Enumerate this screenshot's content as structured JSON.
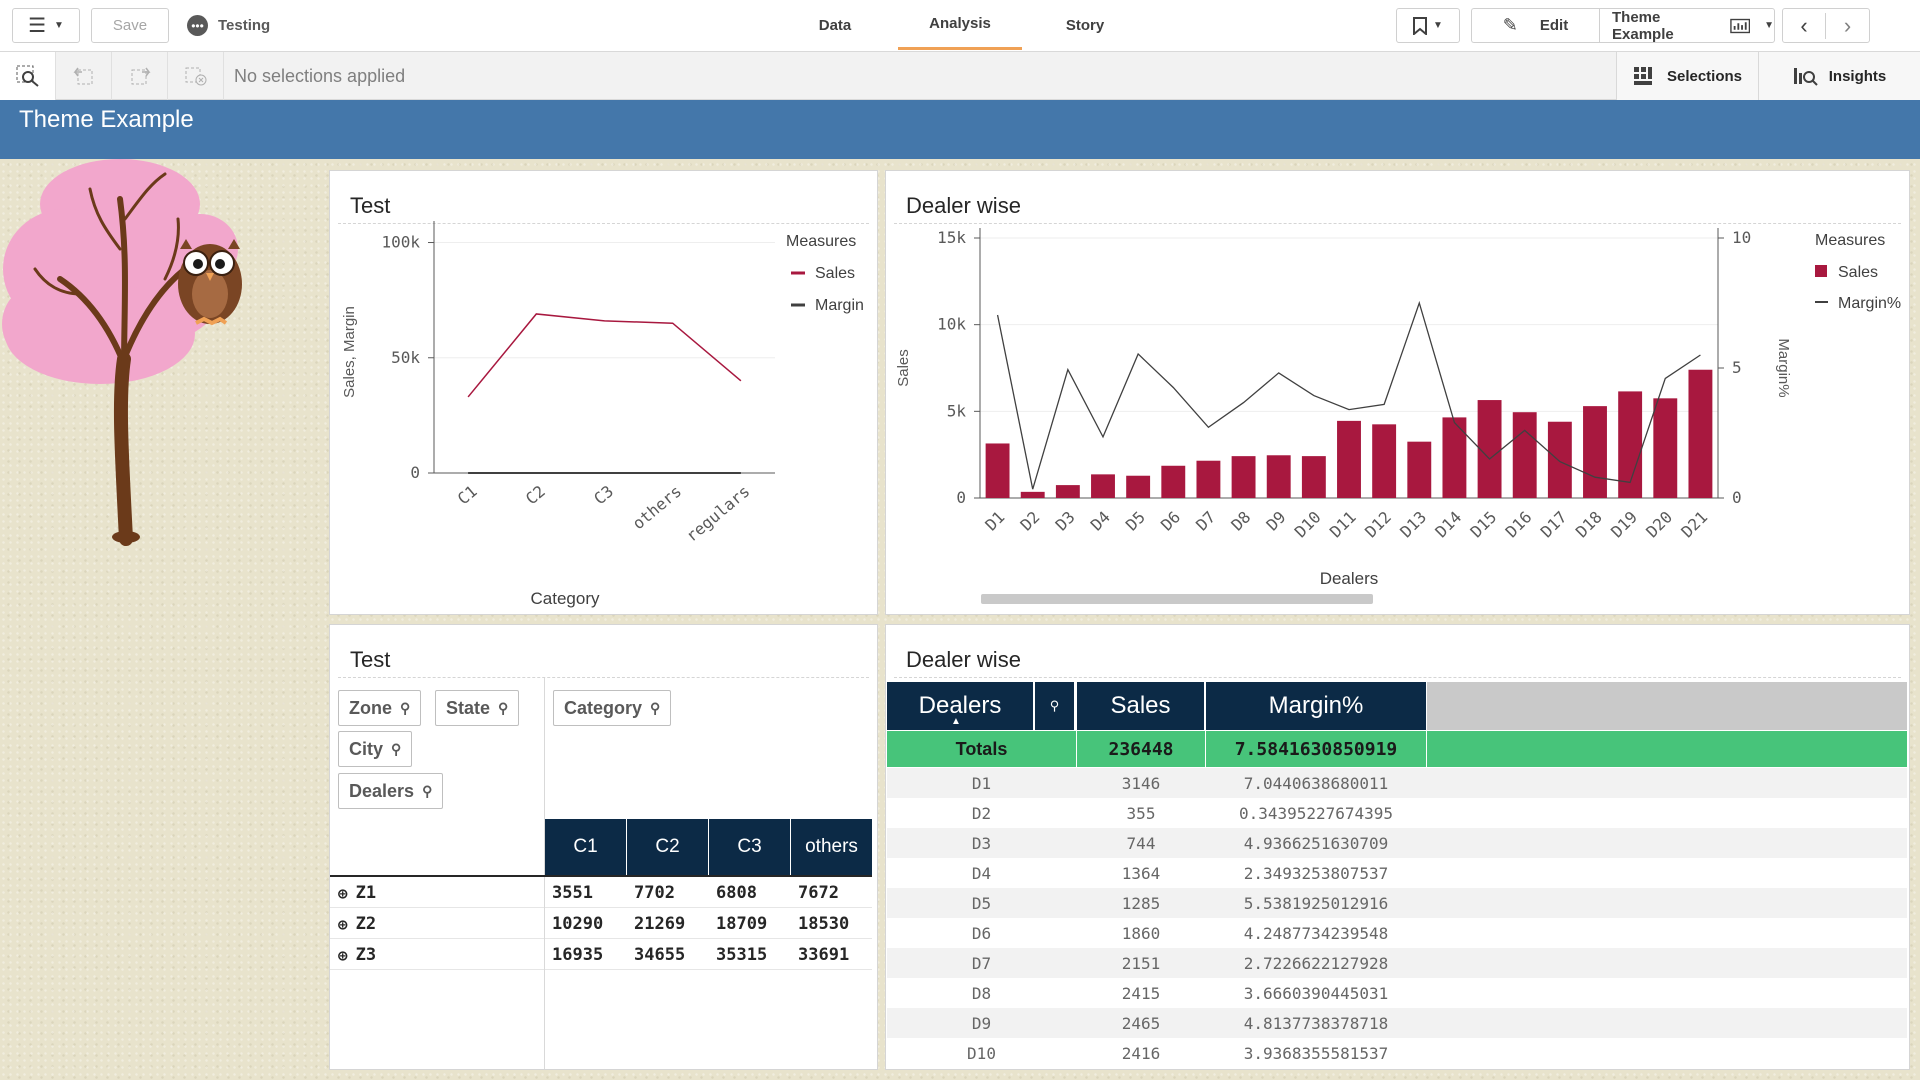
{
  "toolbar": {
    "save_label": "Save",
    "app_name": "Testing",
    "tabs": [
      {
        "label": "Data"
      },
      {
        "label": "Analysis"
      },
      {
        "label": "Story"
      }
    ],
    "edit_label": "Edit",
    "sheet_name": "Theme Example"
  },
  "selections_bar": {
    "placeholder": "No selections applied",
    "selections_label": "Selections",
    "insights_label": "Insights"
  },
  "sheet": {
    "title": "Theme Example"
  },
  "colors": {
    "title_bar": "#4477aa",
    "accent_tab": "#f0a155",
    "sales": "#a8183f",
    "margin": "#404040",
    "header": "#0c2a46",
    "totals": "#47c47a"
  },
  "line_panel": {
    "title": "Test"
  },
  "combo_panel": {
    "title": "Dealer wise"
  },
  "pivot_panel": {
    "title": "Test",
    "row_dims": [
      "Zone",
      "State",
      "City",
      "Dealers"
    ],
    "col_dim": "Category",
    "columns": [
      "C1",
      "C2",
      "C3",
      "others"
    ],
    "rows": [
      {
        "label": "Z1",
        "values": [
          "3551",
          "7702",
          "6808",
          "7672"
        ]
      },
      {
        "label": "Z2",
        "values": [
          "10290",
          "21269",
          "18709",
          "18530"
        ]
      },
      {
        "label": "Z3",
        "values": [
          "16935",
          "34655",
          "35315",
          "33691"
        ]
      }
    ]
  },
  "table_panel": {
    "title": "Dealer wise",
    "headers": [
      "Dealers",
      "Sales",
      "Margin%"
    ],
    "totals": {
      "label": "Totals",
      "sales": "236448",
      "margin": "7.5841630850919"
    },
    "rows": [
      {
        "dealer": "D1",
        "sales": "3146",
        "margin": "7.0440638680011"
      },
      {
        "dealer": "D2",
        "sales": "355",
        "margin": "0.34395227674395"
      },
      {
        "dealer": "D3",
        "sales": "744",
        "margin": "4.9366251630709"
      },
      {
        "dealer": "D4",
        "sales": "1364",
        "margin": "2.3493253807537"
      },
      {
        "dealer": "D5",
        "sales": "1285",
        "margin": "5.5381925012916"
      },
      {
        "dealer": "D6",
        "sales": "1860",
        "margin": "4.2487734239548"
      },
      {
        "dealer": "D7",
        "sales": "2151",
        "margin": "2.7226622127928"
      },
      {
        "dealer": "D8",
        "sales": "2415",
        "margin": "3.6660390445031"
      },
      {
        "dealer": "D9",
        "sales": "2465",
        "margin": "4.8137738378718"
      },
      {
        "dealer": "D10",
        "sales": "2416",
        "margin": "3.9368355581537"
      }
    ]
  },
  "chart_data": [
    {
      "type": "line",
      "title": "Test",
      "xlabel": "Category",
      "ylabel": "Sales, Margin",
      "legend_title": "Measures",
      "legend_position": "right",
      "categories": [
        "C1",
        "C2",
        "C3",
        "others",
        "regulars"
      ],
      "yticks": [
        "0",
        "50k",
        "100k"
      ],
      "ylim": [
        0,
        105000
      ],
      "grid": true,
      "series": [
        {
          "name": "Sales",
          "values": [
            33000,
            69000,
            66000,
            65000,
            40000
          ]
        },
        {
          "name": "Margin",
          "values": [
            5,
            7,
            7,
            8,
            6
          ]
        }
      ]
    },
    {
      "type": "bar",
      "title": "Dealer wise",
      "xlabel": "Dealers",
      "ylabel": "Sales",
      "y2label": "Margin%",
      "legend_title": "Measures",
      "legend_position": "right",
      "categories": [
        "D1",
        "D2",
        "D3",
        "D4",
        "D5",
        "D6",
        "D7",
        "D8",
        "D9",
        "D10",
        "D11",
        "D12",
        "D13",
        "D14",
        "D15",
        "D16",
        "D17",
        "D18",
        "D19",
        "D20",
        "D21"
      ],
      "yticks": [
        "0",
        "5k",
        "10k",
        "15k"
      ],
      "y2ticks": [
        "0",
        "5",
        "10"
      ],
      "ylim": [
        0,
        15000
      ],
      "y2lim": [
        0,
        10
      ],
      "grid": true,
      "series": [
        {
          "name": "Sales",
          "kind": "bar",
          "values": [
            3146,
            355,
            744,
            1364,
            1285,
            1860,
            2151,
            2415,
            2465,
            2416,
            4450,
            4250,
            3250,
            4650,
            5650,
            4950,
            4400,
            5300,
            6150,
            5750,
            7400
          ]
        },
        {
          "name": "Margin%",
          "kind": "line",
          "values": [
            7.04,
            0.34,
            4.94,
            2.35,
            5.54,
            4.25,
            2.72,
            3.67,
            4.81,
            3.94,
            3.4,
            3.6,
            7.5,
            2.9,
            1.5,
            2.6,
            1.4,
            0.8,
            0.6,
            4.6,
            5.5
          ]
        }
      ]
    }
  ]
}
